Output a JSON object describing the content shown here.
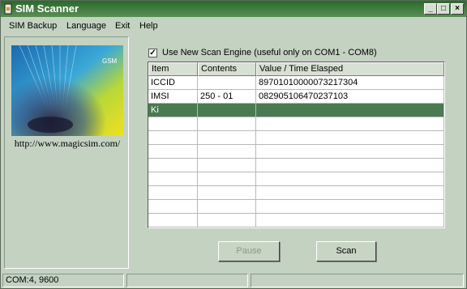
{
  "window": {
    "title": "SIM Scanner"
  },
  "menu": {
    "items": [
      "SIM Backup",
      "Language",
      "Exit",
      "Help"
    ]
  },
  "logo": {
    "badge": "GSM",
    "url": "http://www.magicsim.com/"
  },
  "options": {
    "scan_engine_label": "Use New Scan Engine (useful only on COM1 - COM8)",
    "scan_engine_checked": true
  },
  "table": {
    "columns": [
      "Item",
      "Contents",
      "Value / Time Elasped"
    ],
    "rows": [
      {
        "item": "ICCID",
        "contents": "",
        "value": "89701010000073217304",
        "selected": false
      },
      {
        "item": "IMSI",
        "contents": "250 - 01",
        "value": "082905106470237103",
        "selected": false
      },
      {
        "item": "Ki",
        "contents": "",
        "value": "",
        "selected": true
      }
    ]
  },
  "buttons": {
    "pause_label": "Pause",
    "pause_enabled": false,
    "scan_label": "Scan"
  },
  "status": {
    "port": "COM:4, 9600",
    "panel2": "",
    "panel3": ""
  },
  "colors": {
    "titlebar": "#2a6a2a",
    "selection": "#4a7a52",
    "background": "#c4d2c2"
  }
}
